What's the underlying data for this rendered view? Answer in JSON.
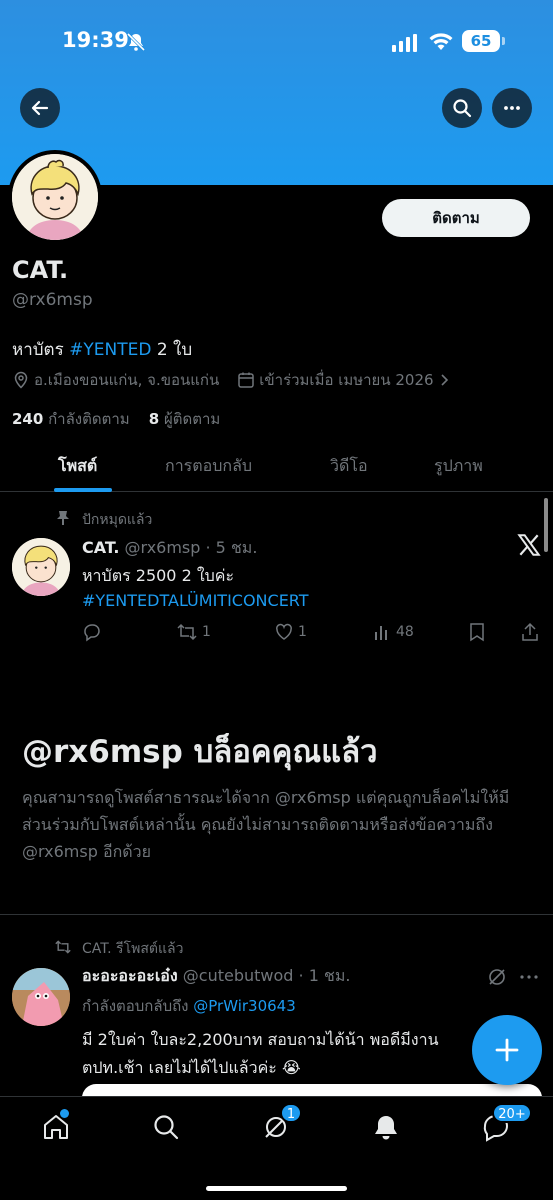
{
  "status_bar": {
    "time": "19:39",
    "battery": "65"
  },
  "profile": {
    "name": "CAT.",
    "handle": "@rx6msp",
    "follow_label": "ติดตาม",
    "bio_prefix": "หาบัตร ",
    "bio_hashtag": "#YENTED",
    "bio_suffix": " 2 ใบ",
    "location": "อ.เมืองขอนแก่น, จ.ขอนแก่น",
    "joined": "เข้าร่วมเมื่อ เมษายน 2026",
    "following_count": "240",
    "following_label": "กำลังติดตาม",
    "followers_count": "8",
    "followers_label": "ผู้ติดตาม"
  },
  "tabs": [
    {
      "label": "โพสต์",
      "active": true
    },
    {
      "label": "การตอบกลับ",
      "active": false
    },
    {
      "label": "วิดีโอ",
      "active": false
    },
    {
      "label": "รูปภาพ",
      "active": false
    }
  ],
  "pinned_post": {
    "pinned_label": "ปักหมุดแล้ว",
    "author": "CAT.",
    "meta": " @rx6msp · 5 ชม.",
    "text": "หาบัตร 2500  2 ใบค่ะ",
    "hashtag": "#YENTEDTALÜMITICONCERT",
    "replies": "",
    "reposts": "1",
    "likes": "1",
    "views": "48"
  },
  "blocked": {
    "title": "@rx6msp บล็อคคุณแล้ว",
    "description": "คุณสามารถดูโพสต์สาธารณะได้จาก @rx6msp แต่คุณถูกบล็อคไม่ให้มีส่วนร่วมกับโพสต์เหล่านั้น คุณยังไม่สามารถติดตามหรือส่งข้อความถึง @rx6msp อีกด้วย"
  },
  "repost": {
    "repost_label": "CAT. รีโพสต์แล้ว",
    "author": "อะอะอะอะเอ๋ง",
    "meta": " @cutebutwod · 1 ชม.",
    "reply_prefix": "กำลังตอบกลับถึง ",
    "reply_handle": "@PrWir30643",
    "text": "มี 2ใบค่า ใบละ2,200บาท สอบถามได้น้า พอดีมีงาน ตปท.เช้า เลยไม่ได้ไปแล้วค่ะ 😭"
  },
  "nav": {
    "grok_badge": "1",
    "messages_badge": "20+"
  },
  "colors": {
    "accent": "#1d9bf0",
    "background": "#000000",
    "muted": "#71767b"
  },
  "icons": [
    "back-icon",
    "search-icon",
    "more-icon",
    "location-icon",
    "calendar-icon",
    "pin-icon",
    "x-logo-icon",
    "reply-icon",
    "repost-icon",
    "like-icon",
    "views-icon",
    "bookmark-icon",
    "share-icon",
    "plus-icon",
    "home-icon",
    "grok-icon",
    "bell-icon",
    "messages-icon"
  ]
}
